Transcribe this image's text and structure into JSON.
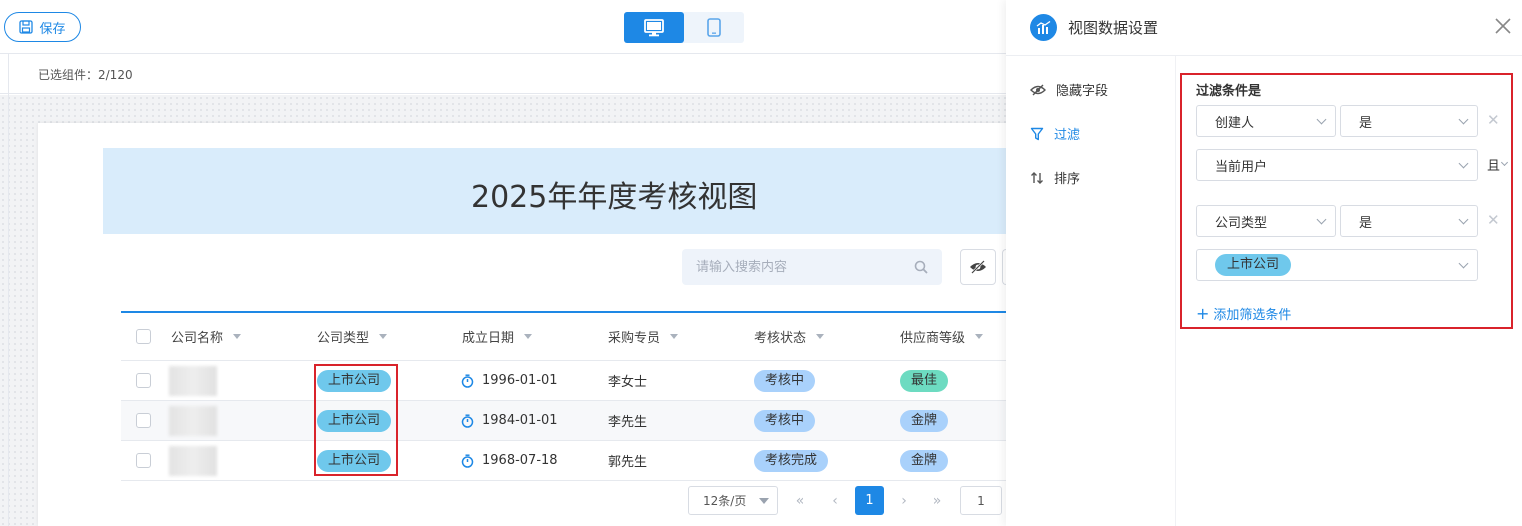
{
  "toolbar": {
    "save_label": "保存"
  },
  "subbar": {
    "selected_count": "已选组件：2/120"
  },
  "view": {
    "title": "2025年年度考核视图",
    "search_placeholder": "请输入搜索内容"
  },
  "table": {
    "columns": [
      "公司名称",
      "公司类型",
      "成立日期",
      "采购专员",
      "考核状态",
      "供应商等级"
    ],
    "rows": [
      {
        "company_type": "上市公司",
        "date": "1996-01-01",
        "buyer": "李女士",
        "status": "考核中",
        "grade": "最佳"
      },
      {
        "company_type": "上市公司",
        "date": "1984-01-01",
        "buyer": "李先生",
        "status": "考核中",
        "grade": "金牌"
      },
      {
        "company_type": "上市公司",
        "date": "1968-07-18",
        "buyer": "郭先生",
        "status": "考核完成",
        "grade": "金牌"
      }
    ]
  },
  "pagination": {
    "page_size": "12条/页",
    "current_page": "1",
    "jump_value": "1"
  },
  "panel": {
    "title": "视图数据设置",
    "nav": [
      {
        "label": "隐藏字段",
        "icon": "eye-off-icon"
      },
      {
        "label": "过滤",
        "icon": "filter-icon"
      },
      {
        "label": "排序",
        "icon": "sort-icon"
      }
    ],
    "filter": {
      "title": "过滤条件是",
      "conditions": [
        {
          "field": "创建人",
          "operator": "是",
          "value": "当前用户",
          "logic": "且"
        },
        {
          "field": "公司类型",
          "operator": "是",
          "value_tag": "上市公司"
        }
      ],
      "add_label": "添加筛选条件"
    }
  },
  "colors": {
    "accent": "#1e88e5",
    "highlight": "#d9232b",
    "tag_listed": "#6fc8ec",
    "tag_status": "#a9d1fb",
    "tag_best": "#6ddbc1"
  }
}
